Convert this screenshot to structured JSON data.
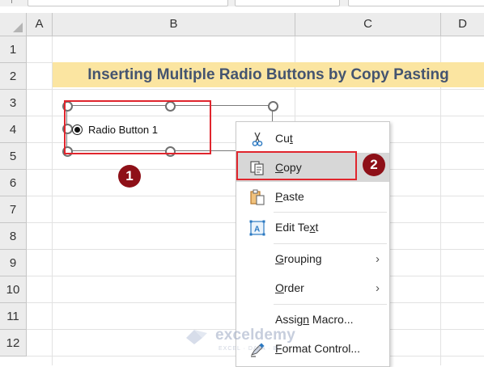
{
  "sheet": {
    "columns": [
      "A",
      "B",
      "C",
      "D"
    ],
    "rows": [
      "1",
      "2",
      "3",
      "4",
      "5",
      "6",
      "7",
      "8",
      "9",
      "10",
      "11",
      "12"
    ],
    "title": "Inserting Multiple Radio Buttons by Copy Pasting"
  },
  "control": {
    "label": "Radio Button 1",
    "selected": true
  },
  "badges": [
    "1",
    "2"
  ],
  "context_menu": {
    "items": [
      {
        "pre": "Cu",
        "accel": "t",
        "post": "",
        "icon": "scissors-icon",
        "submenu": false
      },
      {
        "pre": "",
        "accel": "C",
        "post": "opy",
        "icon": "copy-icon",
        "submenu": false,
        "highlighted": true
      },
      {
        "pre": "",
        "accel": "P",
        "post": "aste",
        "icon": "paste-icon",
        "submenu": false
      },
      {
        "pre": "Edit Te",
        "accel": "x",
        "post": "t",
        "icon": "edit-text-icon",
        "submenu": false
      },
      {
        "pre": "",
        "accel": "G",
        "post": "rouping",
        "icon": "",
        "submenu": true
      },
      {
        "pre": "",
        "accel": "O",
        "post": "rder",
        "icon": "",
        "submenu": true
      },
      {
        "pre": "Assig",
        "accel": "n",
        "post": " Macro...",
        "icon": "",
        "submenu": false
      },
      {
        "pre": "",
        "accel": "F",
        "post": "ormat Control...",
        "icon": "format-control-icon",
        "submenu": false
      }
    ],
    "submenu_glyph": "›"
  },
  "watermark": {
    "name": "exceldemy",
    "tagline": "EXCEL · DATA · BI"
  },
  "colors": {
    "title_fill": "#fbe5a1",
    "title_text": "#445470",
    "highlight_border": "#e0252d",
    "badge_fill": "#8e1018",
    "menu_highlight": "#d7d7d7"
  }
}
